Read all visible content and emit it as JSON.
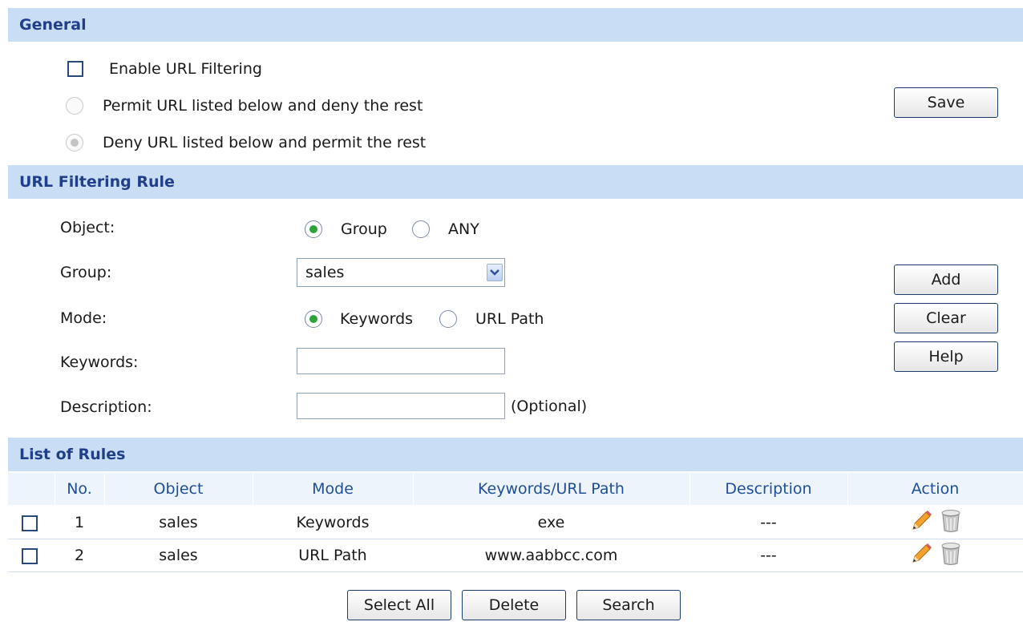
{
  "general": {
    "title": "General",
    "enable_label": "Enable URL Filtering",
    "enable_checked": false,
    "permit_label": "Permit URL listed below and deny the rest",
    "deny_label": "Deny URL listed below and permit the rest",
    "selected_policy": "deny",
    "save_label": "Save"
  },
  "rule": {
    "title": "URL Filtering Rule",
    "object_label": "Object:",
    "object_options": [
      "Group",
      "ANY"
    ],
    "object_selected": "Group",
    "group_label": "Group:",
    "group_value": "sales",
    "mode_label": "Mode:",
    "mode_options": [
      "Keywords",
      "URL Path"
    ],
    "mode_selected": "Keywords",
    "keywords_label": "Keywords:",
    "keywords_value": "",
    "description_label": "Description:",
    "description_value": "",
    "optional_hint": "(Optional)",
    "add_label": "Add",
    "clear_label": "Clear",
    "help_label": "Help"
  },
  "list": {
    "title": "List of Rules",
    "columns": [
      "No.",
      "Object",
      "Mode",
      "Keywords/URL Path",
      "Description",
      "Action"
    ],
    "rows": [
      {
        "no": "1",
        "object": "sales",
        "mode": "Keywords",
        "path": "exe",
        "description": "---"
      },
      {
        "no": "2",
        "object": "sales",
        "mode": "URL Path",
        "path": "www.aabbcc.com",
        "description": "---"
      }
    ],
    "select_all_label": "Select All",
    "delete_label": "Delete",
    "search_label": "Search"
  },
  "icons": {
    "edit": "pencil-edit-icon",
    "delete": "trash-can-icon"
  },
  "colors": {
    "section_bar": "#c9ddf5",
    "section_text": "#1f3f8a",
    "header_row": "#eef4fc",
    "radio_dot": "#2fa33a"
  }
}
